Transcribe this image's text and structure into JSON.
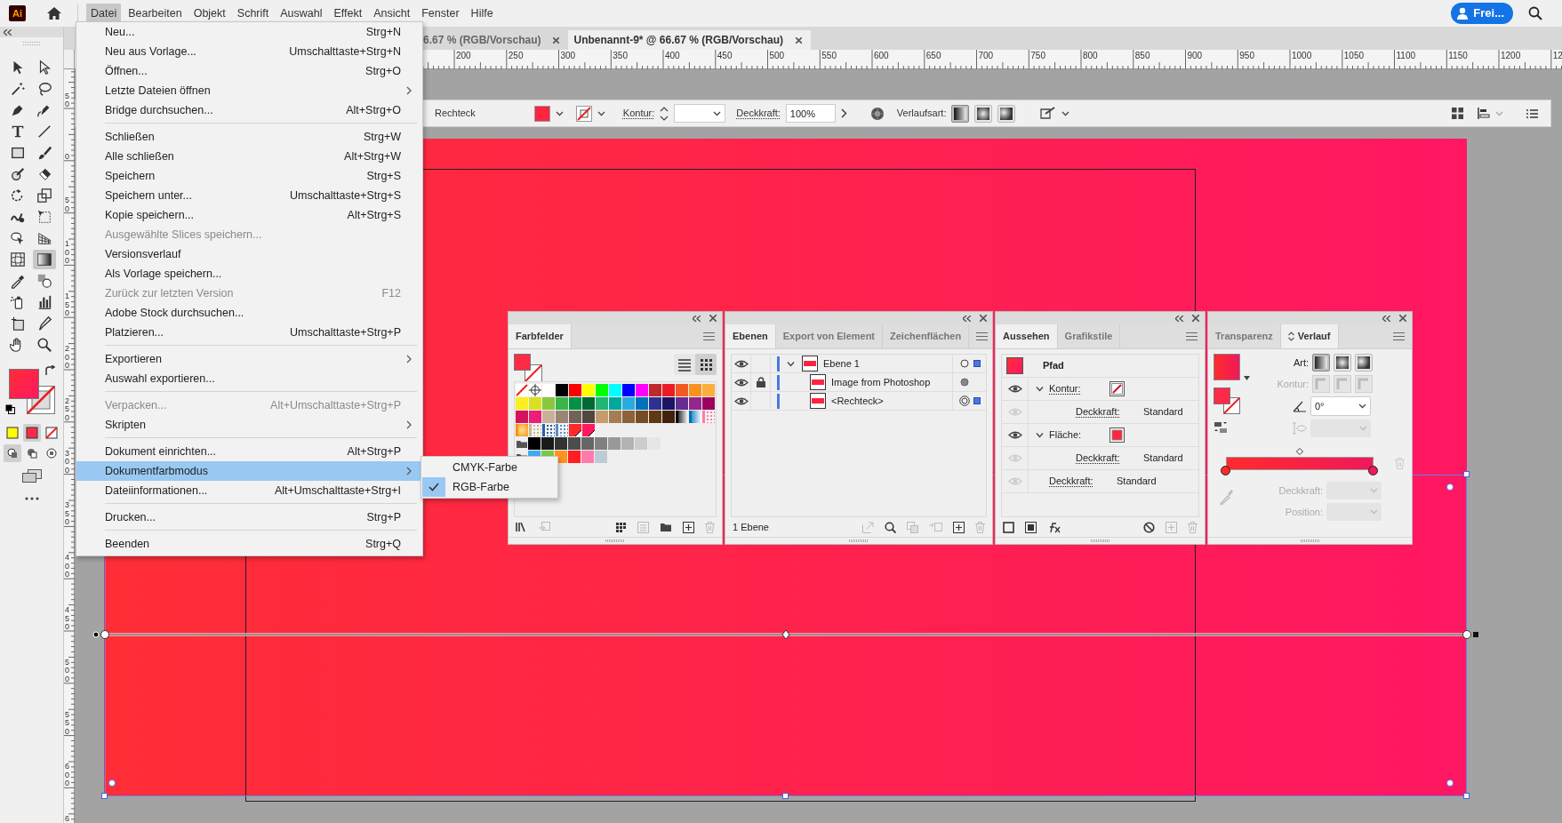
{
  "app_logo": "Ai",
  "menubar": {
    "items": [
      {
        "label": "Datei",
        "selected": true
      },
      {
        "label": "Bearbeiten",
        "selected": false
      },
      {
        "label": "Objekt",
        "selected": false
      },
      {
        "label": "Schrift",
        "selected": false
      },
      {
        "label": "Auswahl",
        "selected": false
      },
      {
        "label": "Effekt",
        "selected": false
      },
      {
        "label": "Ansicht",
        "selected": false
      },
      {
        "label": "Fenster",
        "selected": false
      },
      {
        "label": "Hilfe",
        "selected": false
      }
    ]
  },
  "account_button": {
    "label": "Frei..."
  },
  "document_tabs": [
    {
      "label": "6.67 % (RGB/Vorschau)",
      "selected": false
    },
    {
      "label": "Unbenannt-9* @ 66.67 % (RGB/Vorschau)",
      "selected": true
    }
  ],
  "horizontal_ruler": {
    "labels": [
      "200",
      "250",
      "300",
      "350",
      "400",
      "450",
      "500",
      "550",
      "600",
      "650",
      "700",
      "750",
      "800",
      "850",
      "900",
      "950",
      "1000",
      "1050",
      "1100",
      "1150",
      "1200",
      "12"
    ]
  },
  "vertical_ruler": {
    "labels": [
      "50",
      "0",
      "50",
      "100",
      "150",
      "200",
      "250",
      "300",
      "350",
      "400",
      "450",
      "500",
      "550",
      "600",
      "6"
    ]
  },
  "toolbar": {
    "tools": [
      {
        "selected": false
      },
      {
        "selected": false
      },
      {
        "selected": false
      },
      {
        "selected": false
      },
      {
        "selected": false
      },
      {
        "selected": false
      },
      {
        "selected": false
      },
      {
        "selected": false
      },
      {
        "selected": false
      },
      {
        "selected": false
      },
      {
        "selected": false
      },
      {
        "selected": false
      },
      {
        "selected": false
      },
      {
        "selected": false
      },
      {
        "selected": false
      },
      {
        "selected": false
      },
      {
        "selected": false
      },
      {
        "selected": false
      },
      {
        "selected": false
      },
      {
        "selected": true
      },
      {
        "selected": false
      },
      {
        "selected": false
      },
      {
        "selected": false
      },
      {
        "selected": false
      },
      {
        "selected": false
      },
      {
        "selected": false
      },
      {
        "selected": false
      },
      {
        "selected": false
      }
    ],
    "color_modes": [
      {
        "selected": false
      },
      {
        "selected": true
      },
      {
        "selected": false
      }
    ],
    "draw_modes": [
      {
        "selected": true
      },
      {
        "selected": false
      },
      {
        "selected": false
      }
    ]
  },
  "control_bar": {
    "object_type": "Rechteck",
    "stroke_label": "Kontur:",
    "opacity_label": "Deckkraft:",
    "opacity": "100%",
    "gradient_type_label": "Verlaufsart:",
    "gradient_types": [
      {
        "selected": true
      },
      {
        "selected": false
      },
      {
        "selected": false
      }
    ]
  },
  "file_menu": {
    "items": [
      {
        "kind": "item",
        "label": "Neu...",
        "shortcut": "Strg+N",
        "disabled": false,
        "submenu": false,
        "highlighted": false
      },
      {
        "kind": "item",
        "label": "Neu aus Vorlage...",
        "shortcut": "Umschalttaste+Strg+N",
        "disabled": false,
        "submenu": false,
        "highlighted": false
      },
      {
        "kind": "item",
        "label": "Öffnen...",
        "shortcut": "Strg+O",
        "disabled": false,
        "submenu": false,
        "highlighted": false
      },
      {
        "kind": "item",
        "label": "Letzte Dateien öffnen",
        "disabled": false,
        "submenu": true,
        "highlighted": false
      },
      {
        "kind": "item",
        "label": "Bridge durchsuchen...",
        "shortcut": "Alt+Strg+O",
        "disabled": false,
        "submenu": false,
        "highlighted": false
      },
      {
        "kind": "separator"
      },
      {
        "kind": "item",
        "label": "Schließen",
        "shortcut": "Strg+W",
        "disabled": false,
        "submenu": false,
        "highlighted": false
      },
      {
        "kind": "item",
        "label": "Alle schließen",
        "shortcut": "Alt+Strg+W",
        "disabled": false,
        "submenu": false,
        "highlighted": false
      },
      {
        "kind": "item",
        "label": "Speichern",
        "shortcut": "Strg+S",
        "disabled": false,
        "submenu": false,
        "highlighted": false
      },
      {
        "kind": "item",
        "label": "Speichern unter...",
        "shortcut": "Umschalttaste+Strg+S",
        "disabled": false,
        "submenu": false,
        "highlighted": false
      },
      {
        "kind": "item",
        "label": "Kopie speichern...",
        "shortcut": "Alt+Strg+S",
        "disabled": false,
        "submenu": false,
        "highlighted": false
      },
      {
        "kind": "item",
        "label": "Ausgewählte Slices speichern...",
        "disabled": true,
        "submenu": false,
        "highlighted": false
      },
      {
        "kind": "item",
        "label": "Versionsverlauf",
        "disabled": false,
        "submenu": false,
        "highlighted": false
      },
      {
        "kind": "item",
        "label": "Als Vorlage speichern...",
        "disabled": false,
        "submenu": false,
        "highlighted": false
      },
      {
        "kind": "item",
        "label": "Zurück zur letzten Version",
        "shortcut": "F12",
        "disabled": true,
        "submenu": false,
        "highlighted": false
      },
      {
        "kind": "item",
        "label": "Adobe Stock durchsuchen...",
        "disabled": false,
        "submenu": false,
        "highlighted": false
      },
      {
        "kind": "item",
        "label": "Platzieren...",
        "shortcut": "Umschalttaste+Strg+P",
        "disabled": false,
        "submenu": false,
        "highlighted": false
      },
      {
        "kind": "separator"
      },
      {
        "kind": "item",
        "label": "Exportieren",
        "disabled": false,
        "submenu": true,
        "highlighted": false
      },
      {
        "kind": "item",
        "label": "Auswahl exportieren...",
        "disabled": false,
        "submenu": false,
        "highlighted": false
      },
      {
        "kind": "separator"
      },
      {
        "kind": "item",
        "label": "Verpacken...",
        "shortcut": "Alt+Umschalttaste+Strg+P",
        "disabled": true,
        "submenu": false,
        "highlighted": false
      },
      {
        "kind": "item",
        "label": "Skripten",
        "disabled": false,
        "submenu": true,
        "highlighted": false
      },
      {
        "kind": "separator"
      },
      {
        "kind": "item",
        "label": "Dokument einrichten...",
        "shortcut": "Alt+Strg+P",
        "disabled": false,
        "submenu": false,
        "highlighted": false
      },
      {
        "kind": "item",
        "label": "Dokumentfarbmodus",
        "disabled": false,
        "submenu": true,
        "highlighted": true
      },
      {
        "kind": "item",
        "label": "Dateiinformationen...",
        "shortcut": "Alt+Umschalttaste+Strg+I",
        "disabled": false,
        "submenu": false,
        "highlighted": false
      },
      {
        "kind": "separator"
      },
      {
        "kind": "item",
        "label": "Drucken...",
        "shortcut": "Strg+P",
        "disabled": false,
        "submenu": false,
        "highlighted": false
      },
      {
        "kind": "separator"
      },
      {
        "kind": "item",
        "label": "Beenden",
        "shortcut": "Strg+Q",
        "disabled": false,
        "submenu": false,
        "highlighted": false
      }
    ]
  },
  "color_mode_submenu": {
    "items": [
      {
        "label": "CMYK-Farbe",
        "checked": false
      },
      {
        "label": "RGB-Farbe",
        "checked": true
      }
    ]
  },
  "swatches_panel": {
    "tabs": [
      {
        "label": "Farbfelder",
        "selected": true
      }
    ],
    "views": [
      {
        "selected": false
      },
      {
        "selected": true
      }
    ],
    "rows": [
      {
        "folder": false,
        "swatches": [
          {
            "kind": "none"
          },
          {
            "kind": "registration"
          },
          {
            "kind": "color",
            "color": "#ffffff"
          },
          {
            "kind": "color",
            "color": "#000000"
          },
          {
            "kind": "color",
            "color": "#ff0000"
          },
          {
            "kind": "color",
            "color": "#ffff00"
          },
          {
            "kind": "color",
            "color": "#00ff00"
          },
          {
            "kind": "color",
            "color": "#00ffff"
          },
          {
            "kind": "color",
            "color": "#0000ff"
          },
          {
            "kind": "color",
            "color": "#ff00ff"
          },
          {
            "kind": "color",
            "color": "#c1272d"
          },
          {
            "kind": "color",
            "color": "#ed1c24"
          },
          {
            "kind": "color",
            "color": "#f15a24"
          },
          {
            "kind": "color",
            "color": "#f7931e"
          },
          {
            "kind": "color",
            "color": "#fbb03b"
          }
        ]
      },
      {
        "folder": false,
        "swatches": [
          {
            "kind": "color",
            "color": "#fcee21"
          },
          {
            "kind": "color",
            "color": "#d9e021"
          },
          {
            "kind": "color",
            "color": "#8cc63f"
          },
          {
            "kind": "color",
            "color": "#39b54a"
          },
          {
            "kind": "color",
            "color": "#009245"
          },
          {
            "kind": "color",
            "color": "#006837"
          },
          {
            "kind": "color",
            "color": "#22b573"
          },
          {
            "kind": "color",
            "color": "#00a99d"
          },
          {
            "kind": "color",
            "color": "#29abe2"
          },
          {
            "kind": "color",
            "color": "#0071bc"
          },
          {
            "kind": "color",
            "color": "#2e3192"
          },
          {
            "kind": "color",
            "color": "#1b1464"
          },
          {
            "kind": "color",
            "color": "#662d91"
          },
          {
            "kind": "color",
            "color": "#93278f"
          },
          {
            "kind": "color",
            "color": "#9e005d"
          }
        ]
      },
      {
        "folder": false,
        "swatches": [
          {
            "kind": "color",
            "color": "#d4145a"
          },
          {
            "kind": "color",
            "color": "#ed1e79"
          },
          {
            "kind": "color",
            "color": "#c7b299"
          },
          {
            "kind": "color",
            "color": "#998675"
          },
          {
            "kind": "color",
            "color": "#736357"
          },
          {
            "kind": "color",
            "color": "#534741"
          },
          {
            "kind": "color",
            "color": "#c69c6d"
          },
          {
            "kind": "color",
            "color": "#a67c52"
          },
          {
            "kind": "color",
            "color": "#8c6239"
          },
          {
            "kind": "color",
            "color": "#754c24"
          },
          {
            "kind": "color",
            "color": "#603813"
          },
          {
            "kind": "color",
            "color": "#42210b"
          },
          {
            "kind": "gradient",
            "color": "#000000"
          },
          {
            "kind": "gradient",
            "color": "#0071bc"
          },
          {
            "kind": "pattern",
            "color": "#ff7bac"
          }
        ]
      },
      {
        "folder": false,
        "swatches": [
          {
            "kind": "radial",
            "color": "#f7931e"
          },
          {
            "kind": "pattern",
            "color": "#c8b98a"
          },
          {
            "kind": "pattern",
            "color": "#2a5ea8"
          },
          {
            "kind": "pattern",
            "color": "#5a8ec8"
          },
          {
            "kind": "spot",
            "color": "#ff2a2a"
          },
          {
            "kind": "spot",
            "color": "#ff1a5e"
          }
        ]
      },
      {
        "folder": true,
        "swatches": [
          {
            "kind": "color",
            "color": "#000000"
          },
          {
            "kind": "color",
            "color": "#1a1a1a"
          },
          {
            "kind": "color",
            "color": "#333333"
          },
          {
            "kind": "color",
            "color": "#4d4d4d"
          },
          {
            "kind": "color",
            "color": "#666666"
          },
          {
            "kind": "color",
            "color": "#808080"
          },
          {
            "kind": "color",
            "color": "#999999"
          },
          {
            "kind": "color",
            "color": "#b3b3b3"
          },
          {
            "kind": "color",
            "color": "#cccccc"
          },
          {
            "kind": "color",
            "color": "#e6e6e6"
          }
        ]
      },
      {
        "folder": true,
        "swatches": [
          {
            "kind": "color",
            "color": "#3fa9f5"
          },
          {
            "kind": "color",
            "color": "#7ac943"
          },
          {
            "kind": "color",
            "color": "#ff931e"
          },
          {
            "kind": "color",
            "color": "#ff1d25"
          },
          {
            "kind": "color",
            "color": "#ff7bac"
          },
          {
            "kind": "color",
            "color": "#bdccd4"
          }
        ]
      }
    ]
  },
  "layers_panel": {
    "tabs": [
      {
        "label": "Ebenen",
        "selected": true
      },
      {
        "label": "Export von Element",
        "selected": false
      },
      {
        "label": "Zeichenflächen",
        "selected": false
      }
    ],
    "layers": [
      {
        "kind": "hollow",
        "name": "Ebene 1",
        "visible": true,
        "locked": false,
        "expanded": true,
        "selected": true,
        "children": [
          {
            "kind": "filled",
            "name": "Image from Photoshop",
            "visible": true,
            "locked": true,
            "selected": false
          },
          {
            "kind": "double",
            "name": "<Rechteck>",
            "visible": true,
            "locked": false,
            "selected": true
          }
        ]
      }
    ],
    "count": "1 Ebene"
  },
  "appearance_panel": {
    "tabs": [
      {
        "label": "Aussehen",
        "selected": true
      },
      {
        "label": "Grafikstile",
        "selected": false
      }
    ],
    "title": "Pfad",
    "rows": [
      {
        "kind": "stroke",
        "label": "Kontur:",
        "visible": true,
        "expanded": true,
        "children": [
          {
            "kind": "opacity",
            "label": "Deckkraft:",
            "value": "Standard",
            "visible": false
          }
        ]
      },
      {
        "kind": "fill",
        "label": "Fläche:",
        "visible": true,
        "expanded": true,
        "children": [
          {
            "kind": "opacity",
            "label": "Deckkraft:",
            "value": "Standard",
            "visible": false
          }
        ]
      },
      {
        "kind": "opacity",
        "label": "Deckkraft:",
        "value": "Standard",
        "visible": false
      }
    ]
  },
  "gradient_panel": {
    "tabs": [
      {
        "label": "Transparenz",
        "selected": false,
        "options_toggle": false
      },
      {
        "label": "Verlauf",
        "selected": true,
        "options_toggle": true
      }
    ],
    "type_label": "Art:",
    "types": [
      {
        "selected": true
      },
      {
        "selected": false
      },
      {
        "selected": false
      }
    ],
    "stroke_label": "Kontur:",
    "angle": "0°",
    "stops": [
      {
        "color": "#ff2b2b"
      },
      {
        "color": "#f0195a"
      }
    ],
    "opacity_label": "Deckkraft:",
    "position_label": "Position:"
  }
}
